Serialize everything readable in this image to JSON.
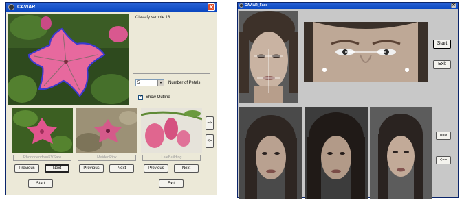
{
  "left_window": {
    "title": "CAVIAR",
    "close": "✕",
    "info_text": "Classify sample 18",
    "petals_value": "5",
    "petals_label": "Number of Petals",
    "show_outline_label": "Show Outline",
    "show_outline_checked": "✓",
    "arrow_right": "=>",
    "arrow_left": "<=",
    "samples": [
      {
        "name": "RhododendronKVSare",
        "prev": "Previous",
        "next": "Next"
      },
      {
        "name": "MaidenPink",
        "prev": "Previous",
        "next": "Next"
      },
      {
        "name": "LaleBuilding",
        "prev": "Previous",
        "next": "Next"
      }
    ],
    "start_label": "Start",
    "exit_label": "Exit"
  },
  "right_window": {
    "title": "CAVIAR_Face",
    "close": "✕",
    "start_label": "Start",
    "exit_label": "Exit",
    "forward_label": "==>",
    "back_label": "<=="
  },
  "colors": {
    "titlebar": "#0a47c0",
    "window_bg": "#ece9d8",
    "outline": "#3a3ad0",
    "face_window_bg": "#c8c8c8"
  }
}
